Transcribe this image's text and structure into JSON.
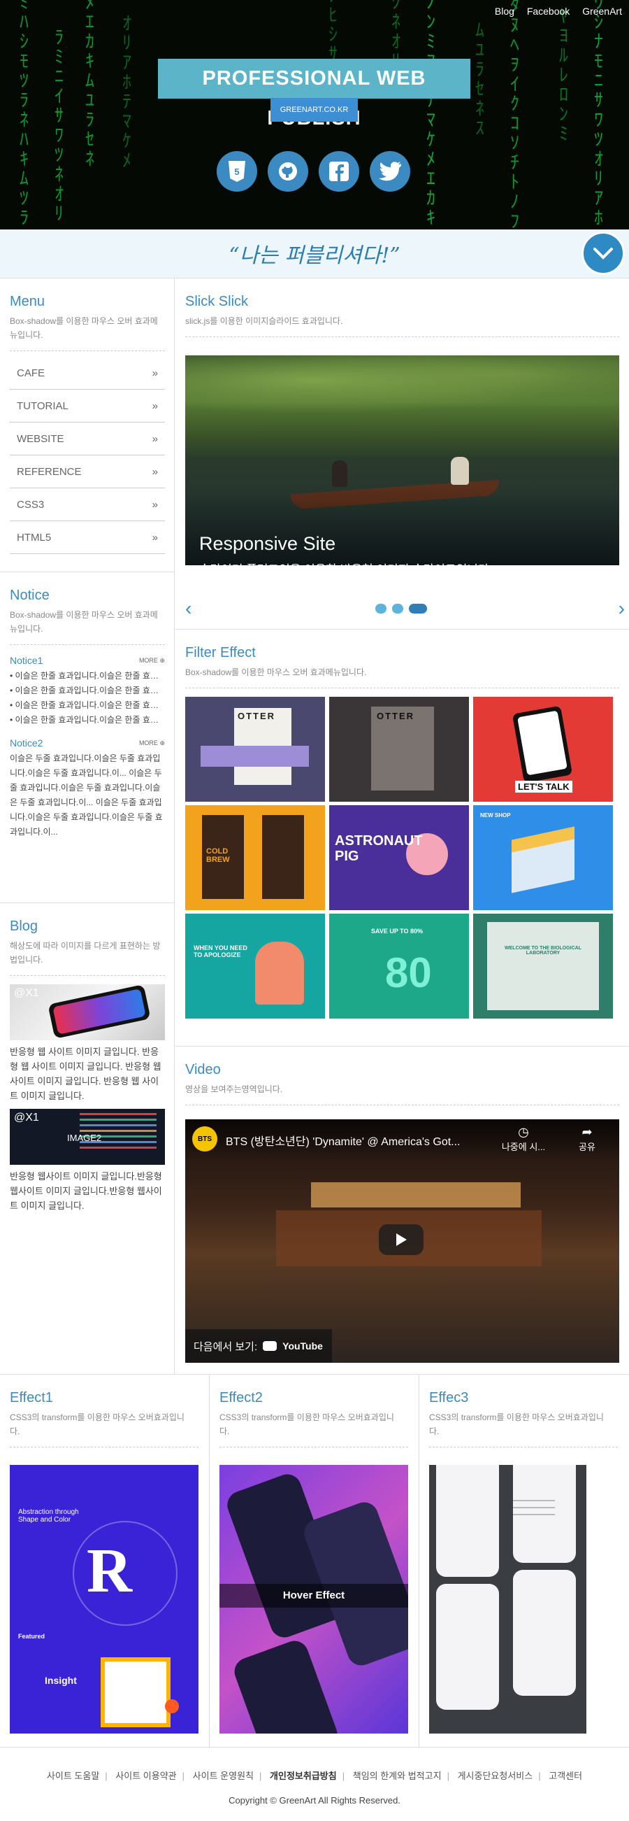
{
  "header": {
    "top_links": [
      "Blog",
      "Facebook",
      "GreenArt"
    ],
    "title": "PROFESSIONAL WEB PUBLISH",
    "site_button": "GREENART.CO.KR",
    "sns_icons": [
      "html5-icon",
      "github-icon",
      "facebook-icon",
      "twitter-icon"
    ],
    "slogan": "“나는 퍼블리셔다!”",
    "down_icon": "chevron-down-icon"
  },
  "menu": {
    "title": "Menu",
    "desc": "Box-shadow를 이용한 마우스 오버 효과메뉴입니다.",
    "items": [
      "CAFE",
      "TUTORIAL",
      "WEBSITE",
      "REFERENCE",
      "CSS3",
      "HTML5"
    ]
  },
  "notice": {
    "title": "Notice",
    "desc": "Box-shadow를 이용한 마우스 오버 효과메뉴입니다.",
    "notice1_title": "Notice1",
    "more1": "MORE",
    "notice1_items": [
      "이슬은 한줄 효과입니다.이슬은 한줄 효과입니다.",
      "이슬은 한줄 효과입니다.이슬은 한줄 효과입니다.",
      "이슬은 한줄 효과입니다.이슬은 한줄 효과입니다.",
      "이슬은 한줄 효과입니다.이슬은 한줄 효과입니다."
    ],
    "notice2_title": "Notice2",
    "more2": "MORE",
    "notice2_text": "이슬은 두줄 효과입니다.이슬은 두줄 효과입니다.이슬은 두줄 효과입니다.이... 이슬은 두줄 효과입니다.이슬은 두줄 효과입니다.이슬은 두줄 효과입니다.이... 이슬은 두줄 효과입니다.이슬은 두줄 효과입니다.이슬은 두줄 효과입니다.이..."
  },
  "blog": {
    "title": "Blog",
    "desc": "해상도에 따라 이미지를 다르게 표현하는 방법입니다.",
    "img1_label": "@X1",
    "text1": "반응형 웹 사이트 이미지 글입니다. 반응형 웹 사이트 이미지 글입니다. 반응형 웹 사이트 이미지 글입니다. 반응형 웹 사이트 이미지 글입니다.",
    "img2_label": "@X1",
    "img2_caption": "IMAGE2",
    "text2": "반응형 웹사이트 이미지 글입니다.반응형 웹사이트 이미지 글입니다.반응형 웹사이트 이미지 글입니다."
  },
  "slick": {
    "title": "Slick Slick",
    "desc": "slick.js를 이용한 이미지슬라이드 효과입니다.",
    "slide_title": "Responsive Site",
    "slide_text": "슬라이더 플러그인을 이용한 반응형 이미지 슬라이드입니다.",
    "active_dot": 3,
    "dot_count": 3
  },
  "filter": {
    "title": "Filter Effect",
    "desc": "Box-shadow를 이용한 마우스 오버 효과메뉴입니다.",
    "thumbs": [
      {
        "text": "OTTER",
        "bg": "#4b4870"
      },
      {
        "text": "OTTER",
        "bg": "#3a3536"
      },
      {
        "text": "LET'S TALK",
        "bg": "#e33a36"
      },
      {
        "text": "COLD BREW",
        "bg": "#f3a21e"
      },
      {
        "text": "ASTRONAUT PIG",
        "bg": "#4a2f9a"
      },
      {
        "text": "NEW SHOP",
        "bg": "#2f8ee8"
      },
      {
        "text": "WHEN YOU NEED TO APOLOGIZE",
        "bg": "#15a6a2"
      },
      {
        "text": "SAVE UP TO 80%",
        "bg": "#1ea88a"
      },
      {
        "text": "WELCOME TO THE BIOLOGICAL LABORATORY",
        "bg": "#2e7e6a"
      }
    ]
  },
  "video": {
    "title": "Video",
    "desc": "영상을 보여주는영역입니다.",
    "channel": "BTS",
    "video_title": "BTS (방탄소년단) 'Dynamite' @ America's Got...",
    "watch_later": "나중에 시...",
    "share": "공유",
    "watch_on": "다음에서 보기:",
    "youtube": "YouTube"
  },
  "effects": [
    {
      "title": "Effect1",
      "desc": "CSS3의 transform를 이용한 마우스 오버효과입니다."
    },
    {
      "title": "Effect2",
      "desc": "CSS3의 transform를 이용한 마우스 오버효과입니다.",
      "hover_label": "Hover Effect"
    },
    {
      "title": "Effec3",
      "desc": "CSS3의 transform를 이용한 마우스 오버효과입니다."
    }
  ],
  "footer": {
    "links": [
      "사이트 도움말",
      "사이트 이용약관",
      "사이트 운영원칙",
      "개인정보취급방침",
      "책임의 한계와 법적고지",
      "게시중단요청서비스",
      "고객센터"
    ],
    "copyright": "Copyright © GreenArt All Rights Reserved."
  },
  "colors": {
    "accent": "#3b8bc2",
    "slogan_bg": "#ecf6fb",
    "title_box": "#5bb4c8"
  }
}
